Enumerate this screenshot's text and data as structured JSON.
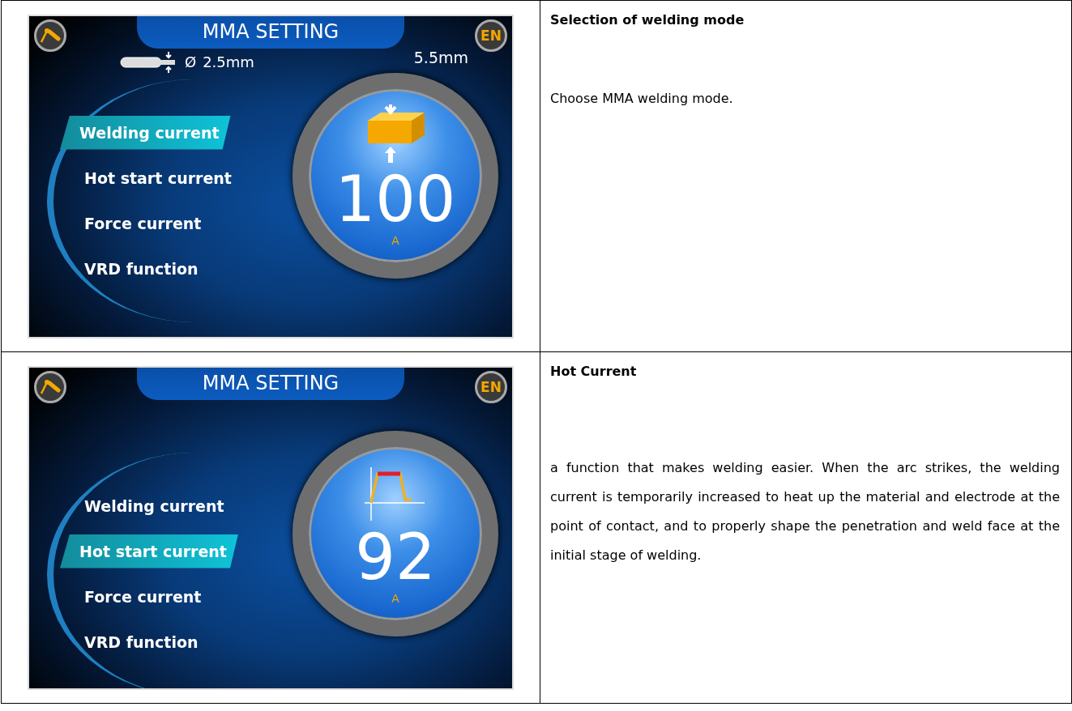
{
  "rows": [
    {
      "screen": {
        "title": "MMA SETTING",
        "language": "EN",
        "electrode": {
          "symbol": "Ø",
          "diameter": "2.5mm",
          "thickness": "5.5mm"
        },
        "menu": [
          {
            "label": "Welding current",
            "selected": true
          },
          {
            "label": "Hot start current",
            "selected": false
          },
          {
            "label": "Force current",
            "selected": false
          },
          {
            "label": "VRD function",
            "selected": false
          }
        ],
        "dial": {
          "kind": "thickness",
          "value": "100",
          "unit": "A"
        }
      },
      "heading": "Selection of welding mode",
      "text": "Choose MMA welding mode."
    },
    {
      "screen": {
        "title": "MMA SETTING",
        "language": "EN",
        "menu": [
          {
            "label": "Welding current",
            "selected": false
          },
          {
            "label": "Hot start current",
            "selected": true
          },
          {
            "label": "Force current",
            "selected": false
          },
          {
            "label": "VRD function",
            "selected": false
          }
        ],
        "dial": {
          "kind": "hot_start",
          "value": "92",
          "unit": "A"
        }
      },
      "heading": "Hot Current",
      "text": "a function that makes welding easier. When the arc strikes, the welding current is temporarily increased to heat up the material and electrode at the point of contact, and to properly shape the penetration and weld face at the initial stage of welding."
    }
  ]
}
